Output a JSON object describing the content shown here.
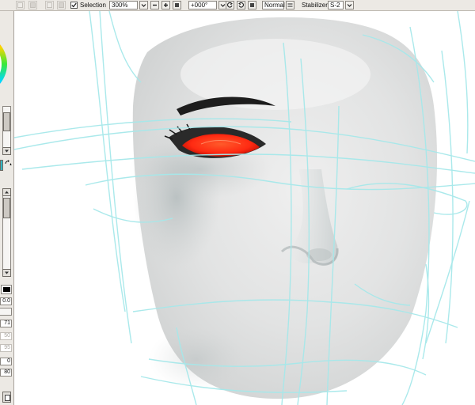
{
  "toolbar": {
    "selection_label": "Selection",
    "selection_checked": true,
    "zoom_value": "300%",
    "rotation_value": "+000°",
    "blend_mode": "Normal",
    "stabilizer_label": "Stabilizer",
    "stabilizer_value": "S-2"
  },
  "left_panel": {
    "size_value": "0.0",
    "values": [
      "71",
      "50",
      "95",
      "0",
      "80"
    ]
  },
  "colors": {
    "iris": "#ff2a12",
    "sketch_lines": "#a6e8ea",
    "panel_bg": "#ece9e4"
  }
}
